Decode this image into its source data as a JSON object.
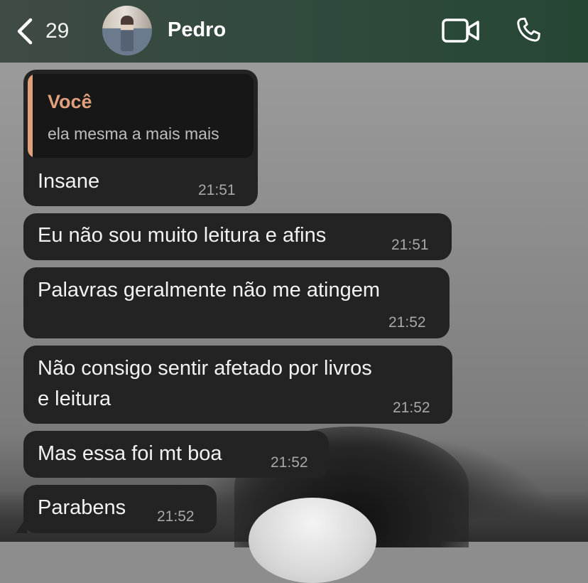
{
  "header": {
    "back_count": "29",
    "contact_name": "Pedro",
    "icons": {
      "back": "chevron-left-icon",
      "video": "video-camera-icon",
      "call": "phone-icon"
    }
  },
  "messages": [
    {
      "reply_to": {
        "author": "Você",
        "text": "ela mesma a mais mais"
      },
      "text": "Insane",
      "time": "21:51"
    },
    {
      "text": "Eu não sou muito leitura e afins",
      "time": "21:51"
    },
    {
      "text": "Palavras geralmente não me atingem",
      "time": "21:52"
    },
    {
      "text_line1": "Não consigo sentir afetado por livros",
      "text_line2": "e leitura",
      "time": "21:52"
    },
    {
      "text": "Mas essa foi mt boa",
      "time": "21:52"
    },
    {
      "text": "Parabens",
      "time": "21:52"
    }
  ],
  "colors": {
    "header_bg": "#2f4a3c",
    "bubble_bg": "#232323",
    "quote_accent": "#e0a07c",
    "timestamp": "#a8a8a8"
  }
}
